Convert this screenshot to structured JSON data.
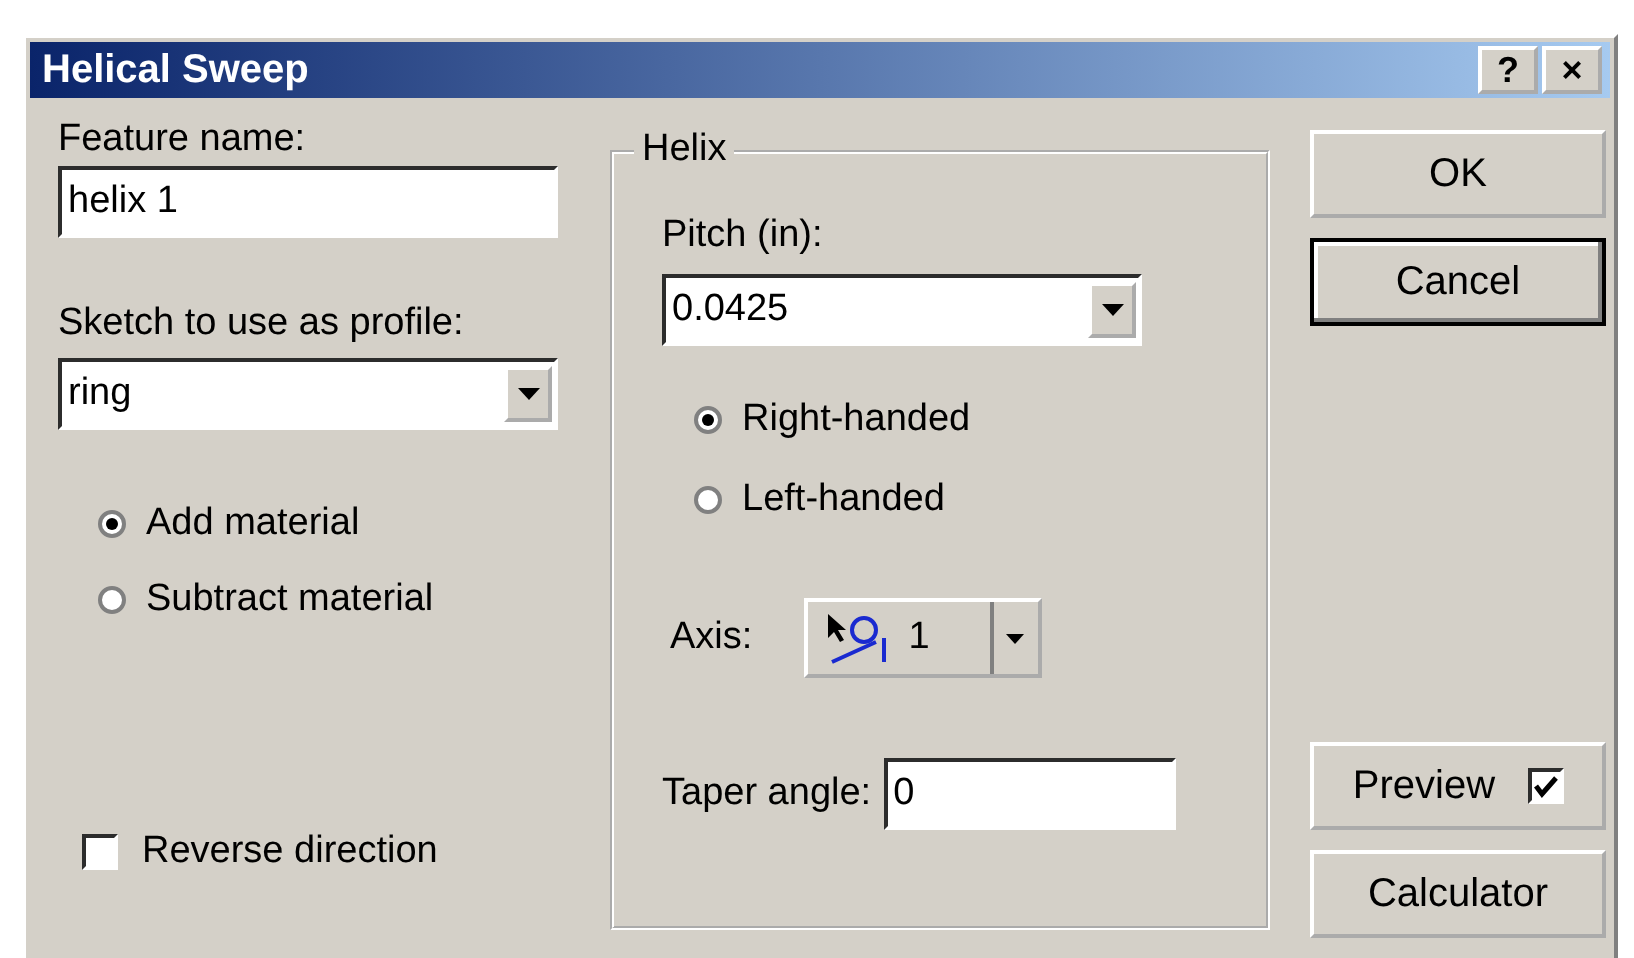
{
  "window": {
    "title": "Helical Sweep",
    "title_buttons": [
      "?",
      "×"
    ]
  },
  "left": {
    "feature_name_label": "Feature name:",
    "feature_name_value": "helix 1",
    "profile_label": "Sketch to use as profile:",
    "profile_value": "ring",
    "operation": [
      {
        "label": "Add material",
        "selected": true
      },
      {
        "label": "Subtract material",
        "selected": false
      }
    ],
    "reverse": {
      "label": "Reverse direction",
      "checked": false
    }
  },
  "helix": {
    "legend": "Helix",
    "pitch_label": "Pitch (in):",
    "pitch_value": "0.0425",
    "handedness": [
      {
        "label": "Right-handed",
        "selected": true
      },
      {
        "label": "Left-handed",
        "selected": false
      }
    ],
    "axis_label": "Axis:",
    "axis_value": "1",
    "taper_label": "Taper angle:",
    "taper_value": "0"
  },
  "buttons": {
    "ok": "OK",
    "cancel": "Cancel",
    "preview": {
      "label": "Preview",
      "checked": true
    },
    "calculator": "Calculator"
  }
}
